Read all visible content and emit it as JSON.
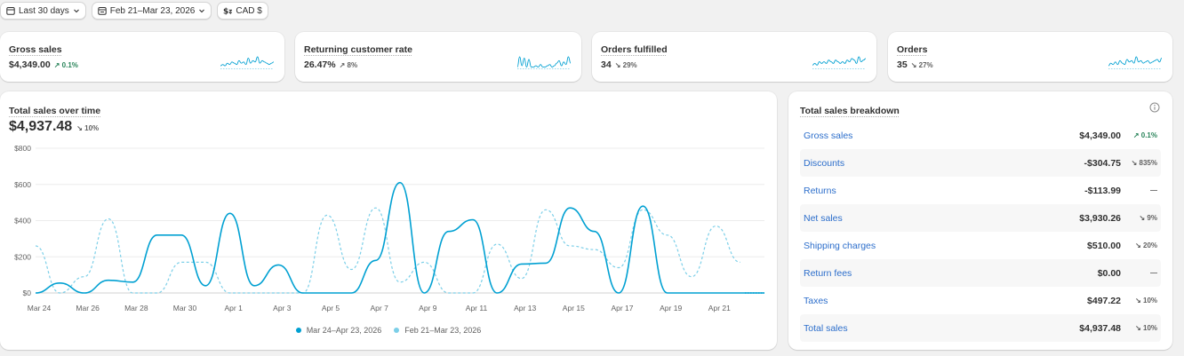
{
  "toolbar": {
    "date_range": "Last 30 days",
    "compare_range": "Feb 21–Mar 23, 2026",
    "currency": "CAD $"
  },
  "kpis": [
    {
      "title": "Gross sales",
      "value": "$4,349.00",
      "delta": "↗ 0.1%",
      "spark": [
        2,
        3,
        2,
        4,
        3,
        5,
        4,
        3,
        6,
        4,
        5,
        3,
        8,
        4,
        6,
        5,
        9,
        4,
        6,
        5,
        4,
        3,
        4,
        5
      ]
    },
    {
      "title": "Returning customer rate",
      "value": "26.47%",
      "delta": "↗ 8%",
      "spark": [
        1,
        9,
        2,
        8,
        1,
        7,
        1,
        1,
        2,
        1,
        3,
        1,
        1,
        2,
        3,
        1,
        2,
        4,
        6,
        2,
        5,
        3,
        9,
        4
      ]
    },
    {
      "title": "Orders fulfilled",
      "value": "34",
      "delta": "↘ 29%",
      "spark": [
        2,
        3,
        2,
        4,
        3,
        4,
        3,
        5,
        4,
        3,
        5,
        4,
        3,
        4,
        3,
        5,
        4,
        6,
        5,
        3,
        7,
        4,
        5,
        6
      ]
    },
    {
      "title": "Orders",
      "value": "35",
      "delta": "↘ 27%",
      "spark": [
        2,
        4,
        3,
        5,
        3,
        6,
        4,
        3,
        7,
        5,
        6,
        4,
        9,
        5,
        6,
        4,
        5,
        6,
        4,
        5,
        6,
        7,
        5,
        8
      ]
    }
  ],
  "sales_chart": {
    "title": "Total sales over time",
    "total": "$4,937.48",
    "delta": "↘ 10%"
  },
  "chart_data": {
    "type": "line",
    "ylim": [
      0,
      800
    ],
    "y_ticks": [
      "$0",
      "$200",
      "$400",
      "$600",
      "$800"
    ],
    "x_ticks": [
      "Mar 24",
      "Mar 26",
      "Mar 28",
      "Mar 30",
      "Apr 1",
      "Apr 3",
      "Apr 5",
      "Apr 7",
      "Apr 9",
      "Apr 11",
      "Apr 13",
      "Apr 15",
      "Apr 17",
      "Apr 19",
      "Apr 21"
    ],
    "series": [
      {
        "name": "Mar 24–Apr 23, 2026",
        "color": "#00a0d2",
        "style": "solid",
        "values": [
          0,
          55,
          0,
          70,
          60,
          320,
          320,
          40,
          440,
          40,
          155,
          0,
          0,
          0,
          180,
          610,
          0,
          340,
          405,
          0,
          160,
          165,
          470,
          340,
          0,
          480,
          0,
          0,
          0,
          0,
          0
        ]
      },
      {
        "name": "Feb 21–Mar 23, 2026",
        "color": "#7ccfe8",
        "style": "dashed",
        "values": [
          260,
          0,
          90,
          410,
          0,
          0,
          170,
          170,
          0,
          0,
          0,
          0,
          430,
          130,
          470,
          60,
          170,
          0,
          0,
          270,
          80,
          460,
          260,
          240,
          140,
          460,
          320,
          90,
          370,
          170
        ]
      }
    ]
  },
  "breakdown": {
    "title": "Total sales breakdown",
    "rows": [
      {
        "label": "Gross sales",
        "value": "$4,349.00",
        "delta": "↗ 0.1%",
        "tone": "up-good"
      },
      {
        "label": "Discounts",
        "value": "-$304.75",
        "delta": "↘ 835%",
        "tone": "gray"
      },
      {
        "label": "Returns",
        "value": "-$113.99",
        "delta": "—",
        "tone": "gray"
      },
      {
        "label": "Net sales",
        "value": "$3,930.26",
        "delta": "↘ 9%",
        "tone": "gray"
      },
      {
        "label": "Shipping charges",
        "value": "$510.00",
        "delta": "↘ 20%",
        "tone": "gray"
      },
      {
        "label": "Return fees",
        "value": "$0.00",
        "delta": "—",
        "tone": "gray"
      },
      {
        "label": "Taxes",
        "value": "$497.22",
        "delta": "↘ 10%",
        "tone": "gray"
      },
      {
        "label": "Total sales",
        "value": "$4,937.48",
        "delta": "↘ 10%",
        "tone": "gray"
      }
    ]
  }
}
